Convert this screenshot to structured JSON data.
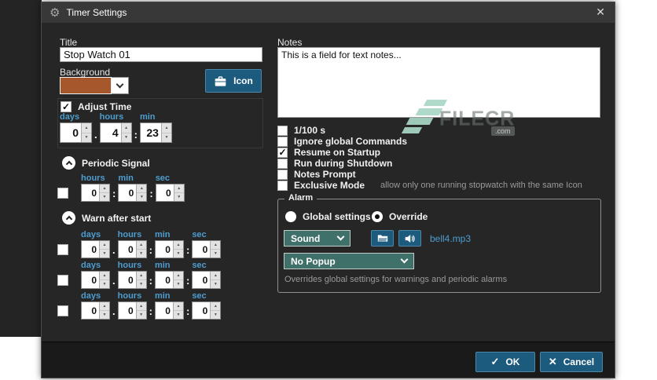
{
  "window": {
    "title": "Timer Settings"
  },
  "seps": {
    "dot": ".",
    "colon": ":"
  },
  "left": {
    "title_label": "Title",
    "title_value": "Stop Watch 01",
    "background_label": "Background",
    "icon_button_label": "Icon",
    "adjust_time_label": "Adjust Time",
    "adjust_time_checked": true,
    "units": {
      "days": "days",
      "hours": "hours",
      "min": "min",
      "sec": "sec"
    },
    "main_time": {
      "days": "0",
      "hours": "4",
      "min": "23"
    },
    "periodic": {
      "header": "Periodic Signal",
      "enabled": false,
      "hours": "0",
      "min": "0",
      "sec": "0"
    },
    "warn": {
      "header": "Warn after start",
      "rows": [
        {
          "enabled": false,
          "days": "0",
          "hours": "0",
          "min": "0",
          "sec": "0"
        },
        {
          "enabled": false,
          "days": "0",
          "hours": "0",
          "min": "0",
          "sec": "0"
        },
        {
          "enabled": false,
          "days": "0",
          "hours": "0",
          "min": "0",
          "sec": "0"
        }
      ]
    }
  },
  "right": {
    "notes_label": "Notes",
    "notes_value": "This is a field for text notes...",
    "options": [
      {
        "label": "1/100 s",
        "checked": false
      },
      {
        "label": "Ignore global Commands",
        "checked": false
      },
      {
        "label": "Resume on Startup",
        "checked": true
      },
      {
        "label": "Run during Shutdown",
        "checked": false
      },
      {
        "label": "Notes Prompt",
        "checked": false
      },
      {
        "label": "Exclusive Mode",
        "checked": false,
        "note": "allow only one running stopwatch with the same Icon"
      }
    ],
    "alarm": {
      "legend": "Alarm",
      "radio_global": {
        "label": "Global settings",
        "selected": false
      },
      "radio_override": {
        "label": "Override",
        "selected": true
      },
      "sound_select": "Sound",
      "sound_file": "bell4.mp3",
      "popup_select": "No Popup",
      "description": "Overrides global settings for warnings and periodic alarms"
    }
  },
  "footer": {
    "ok": "OK",
    "cancel": "Cancel"
  },
  "watermark": {
    "brand": "FILECR",
    "tld": ".com"
  },
  "colors": {
    "accent_blue": "#1c5a7e",
    "label_blue": "#4d9dce",
    "swatch_brown": "#a6582c",
    "combo_teal": "#40706a"
  }
}
